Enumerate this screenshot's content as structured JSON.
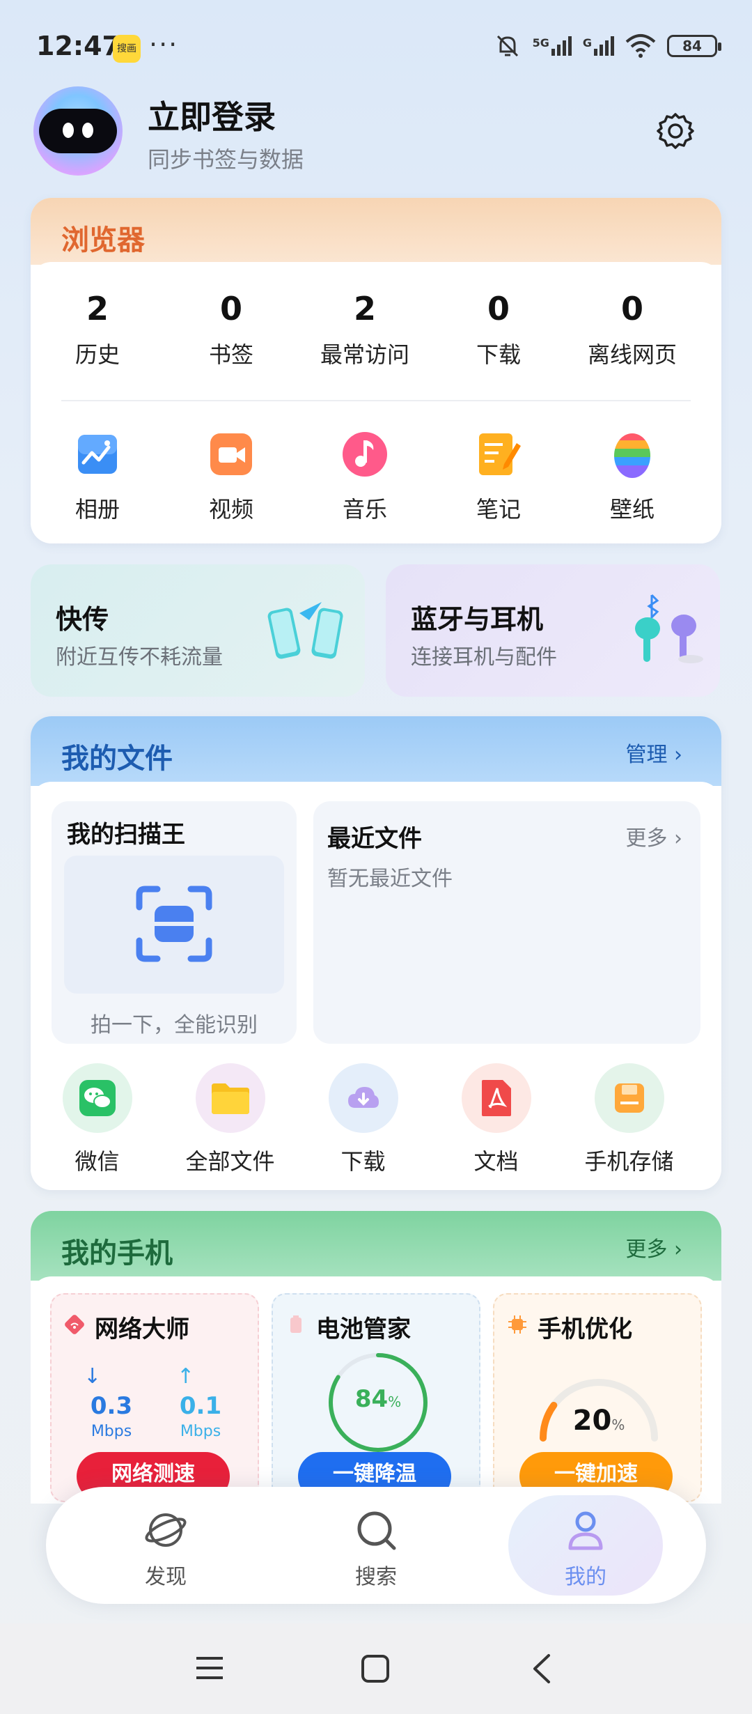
{
  "status_bar": {
    "time": "12:47",
    "app_badge": "搜画",
    "more": "···",
    "network": "5G",
    "network2": "G",
    "battery": "84"
  },
  "profile": {
    "title": "立即登录",
    "subtitle": "同步书签与数据"
  },
  "browser": {
    "title": "浏览器",
    "stats": [
      {
        "num": "2",
        "label": "历史"
      },
      {
        "num": "0",
        "label": "书签"
      },
      {
        "num": "2",
        "label": "最常访问"
      },
      {
        "num": "0",
        "label": "下载"
      },
      {
        "num": "0",
        "label": "离线网页"
      }
    ],
    "tools": [
      {
        "label": "相册",
        "icon": "album-icon"
      },
      {
        "label": "视频",
        "icon": "video-icon"
      },
      {
        "label": "音乐",
        "icon": "music-icon"
      },
      {
        "label": "笔记",
        "icon": "notes-icon"
      },
      {
        "label": "壁纸",
        "icon": "wallpaper-icon"
      }
    ]
  },
  "quick": {
    "transfer": {
      "title": "快传",
      "subtitle": "附近互传不耗流量"
    },
    "bluetooth": {
      "title": "蓝牙与耳机",
      "subtitle": "连接耳机与配件"
    }
  },
  "files": {
    "title": "我的文件",
    "manage": "管理 ›",
    "scanner": {
      "title": "我的扫描王",
      "subtitle": "拍一下，全能识别"
    },
    "recent": {
      "title": "最近文件",
      "more": "更多 ›",
      "empty": "暂无最近文件"
    },
    "shortcuts": [
      {
        "label": "微信",
        "icon": "wechat-icon"
      },
      {
        "label": "全部文件",
        "icon": "folder-icon"
      },
      {
        "label": "下载",
        "icon": "download-cloud-icon"
      },
      {
        "label": "文档",
        "icon": "pdf-icon"
      },
      {
        "label": "手机存储",
        "icon": "storage-icon"
      }
    ]
  },
  "phone": {
    "title": "我的手机",
    "more": "更多 ›",
    "network": {
      "title": "网络大师",
      "down": "0.3",
      "up": "0.1",
      "unit": "Mbps",
      "button": "网络测速"
    },
    "battery": {
      "title": "电池管家",
      "value": "84",
      "unit": "%",
      "level": 0.84,
      "button": "一键降温"
    },
    "optimize": {
      "title": "手机优化",
      "value": "20",
      "unit": "%",
      "level": 0.2,
      "button": "一键加速"
    }
  },
  "bottom_nav": [
    {
      "label": "发现",
      "icon": "planet-icon"
    },
    {
      "label": "搜索",
      "icon": "search-icon"
    },
    {
      "label": "我的",
      "icon": "person-icon"
    }
  ],
  "colors": {
    "accent_orange": "#e0672f",
    "accent_blue": "#1d5cb0",
    "accent_green": "#1e6b3d",
    "active_nav": "#6b8ff0"
  }
}
